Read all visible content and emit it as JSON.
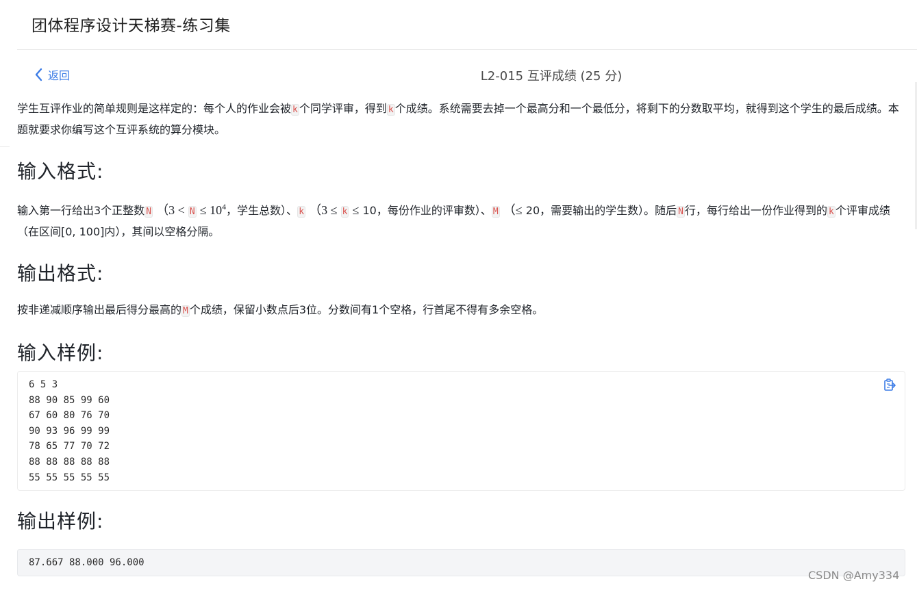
{
  "header": {
    "title": "团体程序设计天梯赛-练习集"
  },
  "nav": {
    "back_label": "返回",
    "problem_title": "L2-015 互评成绩 (25 分)"
  },
  "description": {
    "p1": "学生互评作业的简单规则是这样定的：每个人的作业会被",
    "k1": "k",
    "p2": "个同学评审，得到",
    "k2": "k",
    "p3": "个成绩。系统需要去掉一个最高分和一个最低分，将剩下的分数取平均，就得到这个学生的最后成绩。本题就要求你编写这个互评系统的算分模块。"
  },
  "input_format": {
    "heading": "输入格式:",
    "t1": "输入第一行给出3个正整数",
    "N1": "N",
    "m1": "（3 <",
    "N2": "N",
    "m2": "≤ 10",
    "m2_exp": "4",
    "t2": "，学生总数）、",
    "k1": "k",
    "m3": "（3 ≤",
    "k2": "k",
    "m4": "≤",
    "t3": "10，每份作业的评审数）、",
    "M1": "M",
    "m5": "（≤",
    "t4": "20，需要输出的学生数）。随后",
    "N3": "N",
    "t5": "行，每行给出一份作业得到的",
    "k3": "k",
    "t6": "个评审成绩（在区间[0, 100]内），其间以空格分隔。"
  },
  "output_format": {
    "heading": "输出格式:",
    "t1": "按非递减顺序输出最后得分最高的",
    "M1": "M",
    "t2": "个成绩，保留小数点后3位。分数间有1个空格，行首尾不得有多余空格。"
  },
  "sample_input": {
    "heading": "输入样例:",
    "code": "6 5 3\n88 90 85 99 60\n67 60 80 76 70\n90 93 96 99 99\n78 65 77 70 72\n88 88 88 88 88\n55 55 55 55 55",
    "copy_icon": "clipboard-copy-icon"
  },
  "sample_output": {
    "heading": "输出样例:",
    "code": "87.667 88.000 96.000"
  },
  "watermark": "CSDN @Amy334",
  "colors": {
    "accent": "#3c7ce6",
    "keyword": "#d9534f"
  }
}
